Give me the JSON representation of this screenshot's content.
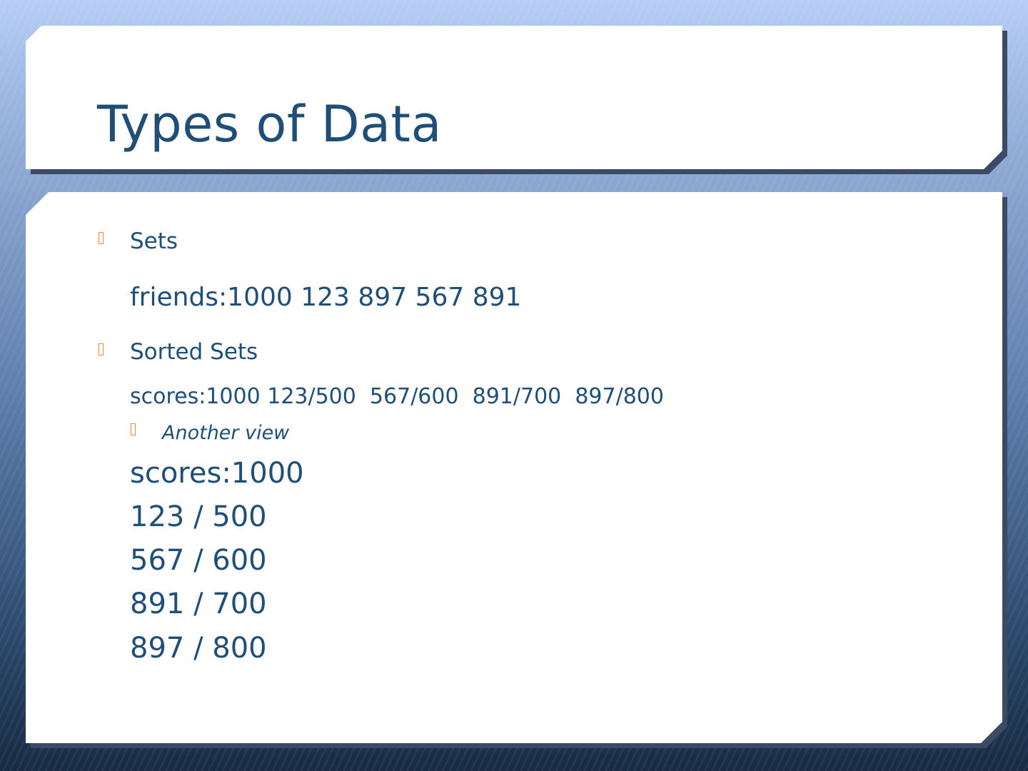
{
  "slide": {
    "title": "Types of Data",
    "bullets": [
      {
        "label": "Sets",
        "detail": "friends:1000 123 897 567 891"
      },
      {
        "label": "Sorted Sets",
        "detail": "scores:1000 123/500  567/600  891/700  897/800"
      }
    ],
    "sub_bullet": "Another view",
    "view_lines": [
      "scores:1000",
      "123 / 500",
      "567 / 600",
      "891 / 700",
      "897 / 800"
    ]
  },
  "colors": {
    "text": "#1f4e79",
    "bullet": "#e8883a",
    "panel": "#ffffff"
  }
}
